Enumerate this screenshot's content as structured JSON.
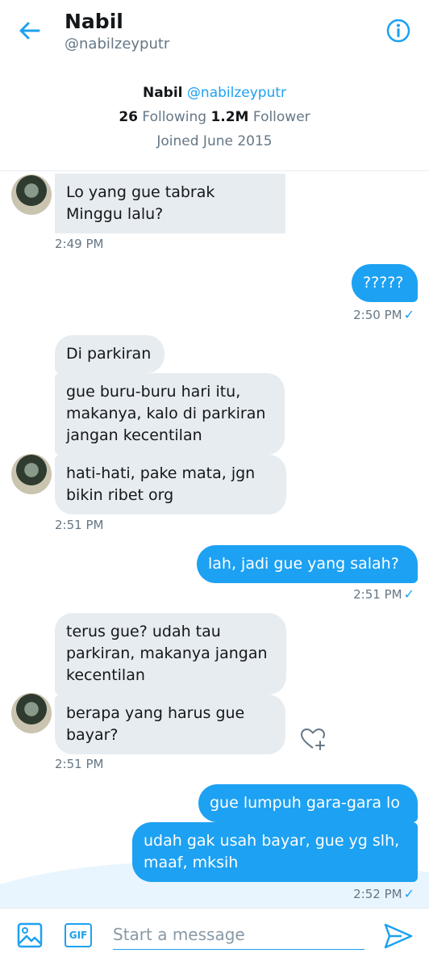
{
  "header": {
    "name": "Nabil",
    "handle": "@nabilzeyputr"
  },
  "profile": {
    "name": "Nabil",
    "handle": "@nabilzeyputr",
    "following_count": "26",
    "following_label": "Following",
    "follower_count": "1.2M",
    "follower_label": "Follower",
    "joined": "Joined June 2015"
  },
  "messages": [
    {
      "from": "them",
      "text": "Lo yang gue tabrak Minggu lalu?"
    },
    {
      "from": "them_time",
      "text": "2:49 PM"
    },
    {
      "from": "me",
      "text": "?????"
    },
    {
      "from": "me_time",
      "text": "2:50 PM"
    },
    {
      "from": "them",
      "text": "Di parkiran"
    },
    {
      "from": "them",
      "text": "gue buru-buru hari itu, makanya, kalo di parkiran jangan kecentilan"
    },
    {
      "from": "them",
      "text": "hati-hati, pake mata, jgn bikin ribet org"
    },
    {
      "from": "them_time",
      "text": "2:51 PM"
    },
    {
      "from": "me",
      "text": "lah, jadi gue yang salah?"
    },
    {
      "from": "me_time",
      "text": "2:51 PM"
    },
    {
      "from": "them",
      "text": "terus gue? udah tau parkiran, makanya jangan kecentilan"
    },
    {
      "from": "them",
      "text": "berapa yang harus gue bayar?"
    },
    {
      "from": "them_time",
      "text": "2:51 PM"
    },
    {
      "from": "me",
      "text": "gue lumpuh gara-gara lo"
    },
    {
      "from": "me",
      "text": "udah gak usah bayar, gue yg slh, maaf, mksih"
    },
    {
      "from": "me_time",
      "text": "2:52 PM"
    }
  ],
  "composer": {
    "placeholder": "Start a message",
    "gif_label": "GIF"
  },
  "icons": {
    "back": "back-arrow-icon",
    "info": "info-icon",
    "image": "image-icon",
    "send": "send-icon",
    "heart": "heart-add-icon",
    "check": "check-icon"
  },
  "colors": {
    "accent": "#1da1f2",
    "incoming_bubble": "#e6ecf0",
    "muted_text": "#657786"
  }
}
